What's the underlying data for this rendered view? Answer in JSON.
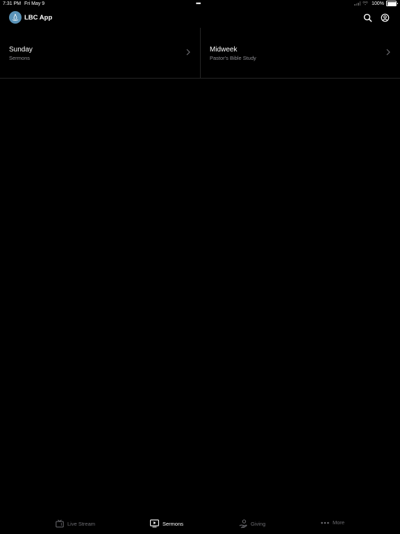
{
  "status_bar": {
    "time": "7:31 PM",
    "date": "Fri May 9",
    "battery_percent": "100%",
    "battery_level": 1.0
  },
  "header": {
    "app_title": "LBC App",
    "logo_color": "#5a93b8",
    "icons": [
      "search-icon",
      "account-icon"
    ]
  },
  "cards": [
    {
      "title": "Sunday",
      "subtitle": "Sermons"
    },
    {
      "title": "Midweek",
      "subtitle": "Pastor's Bible Study"
    }
  ],
  "tab_bar": {
    "active_tab": "Sermons",
    "tabs": [
      {
        "label": "Live Stream",
        "icon": "tv-icon"
      },
      {
        "label": "Sermons",
        "icon": "play-screen-icon"
      },
      {
        "label": "Giving",
        "icon": "giving-hand-icon"
      },
      {
        "label": "More",
        "icon": "ellipsis-icon"
      }
    ]
  },
  "colors": {
    "background": "#000000",
    "divider": "#262626",
    "secondary_text": "#8e8e93",
    "inactive_tab": "#6e6e73",
    "active_tab": "#ffffff"
  }
}
